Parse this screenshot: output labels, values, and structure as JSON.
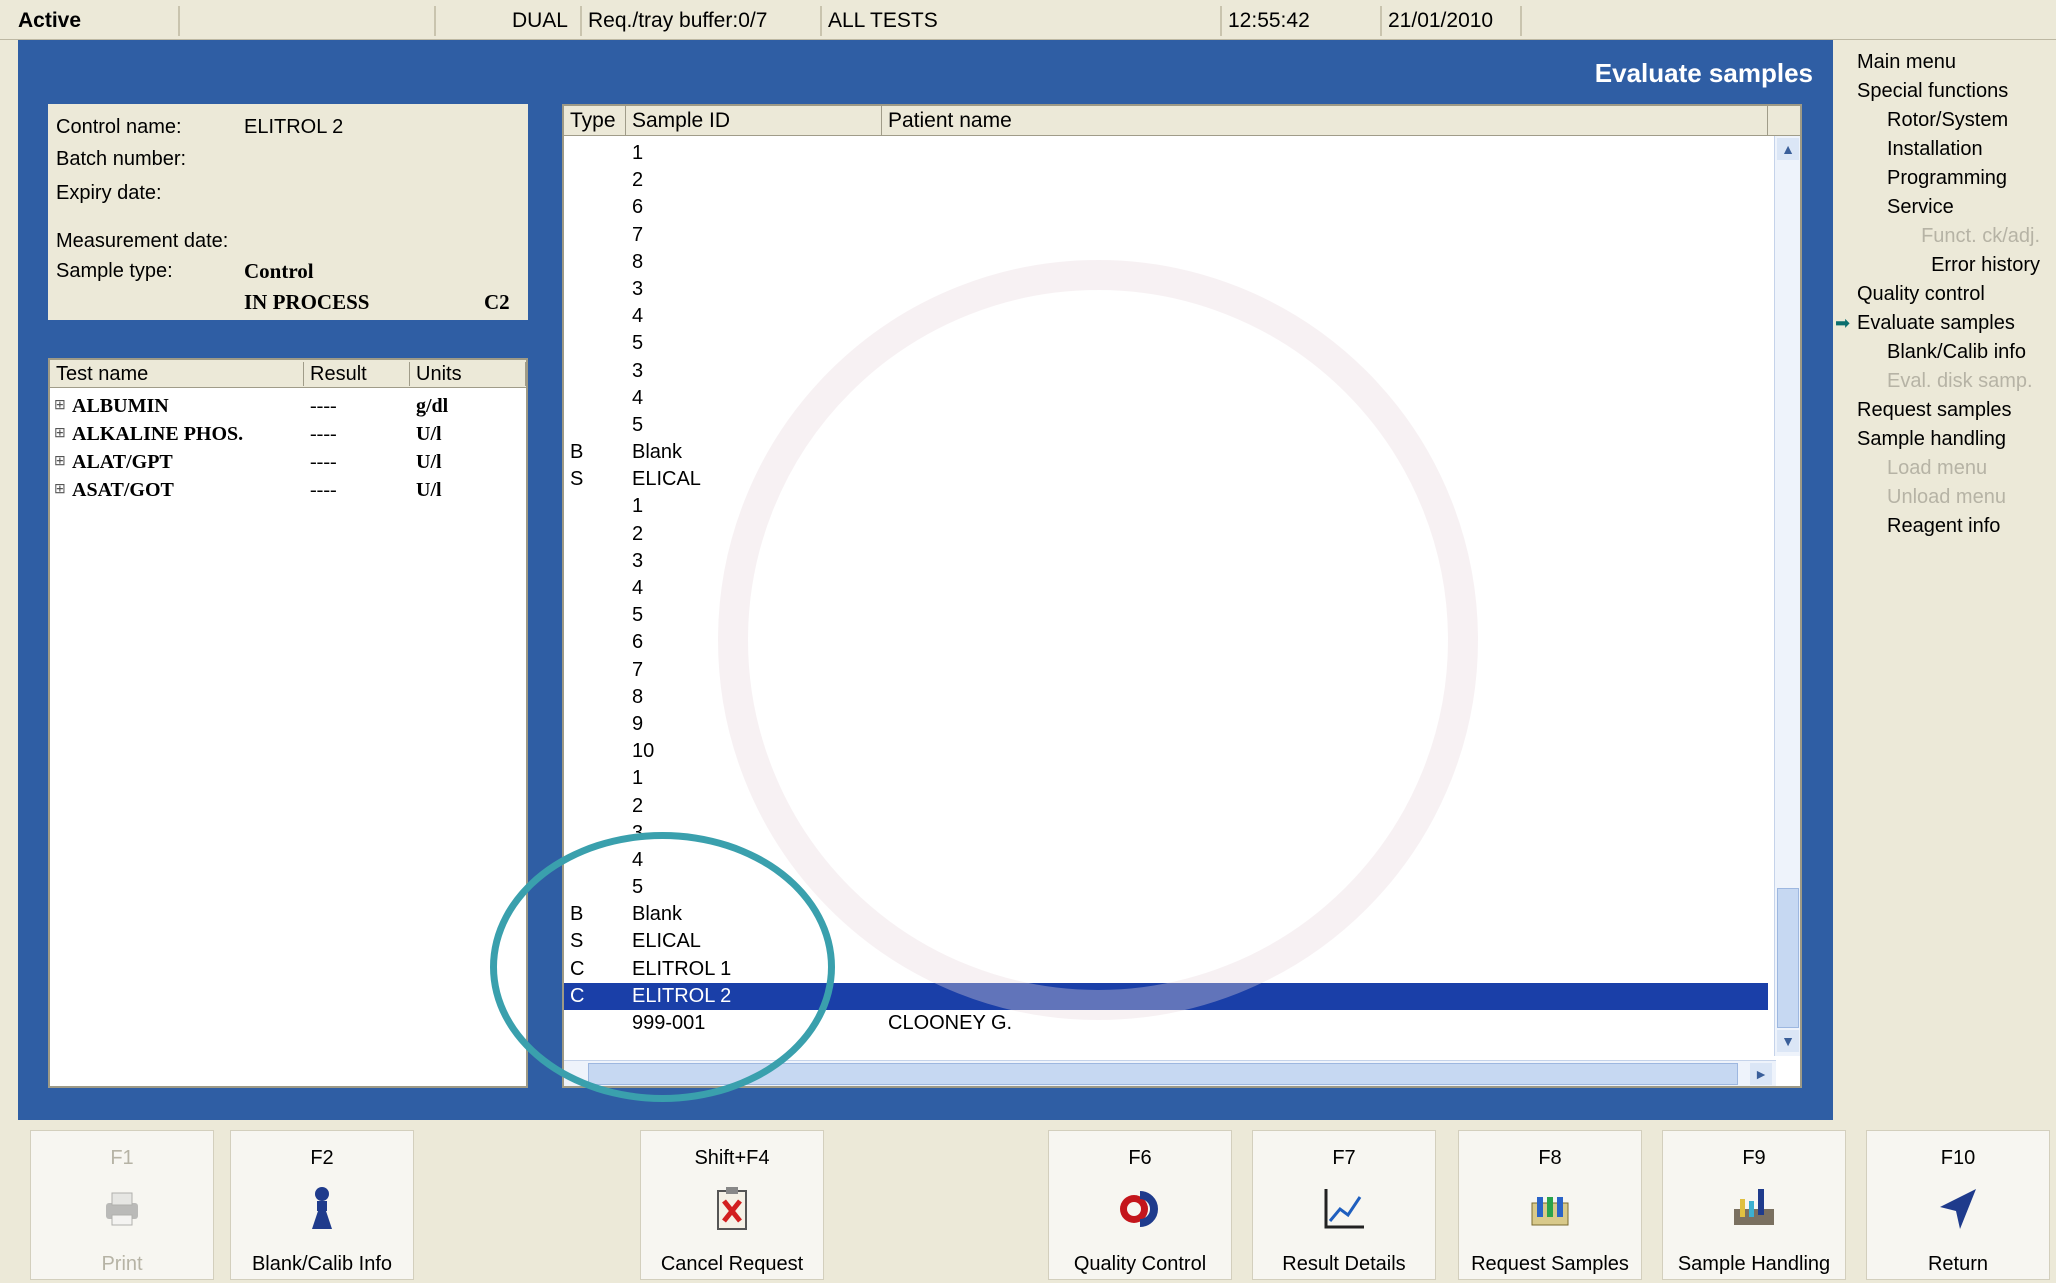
{
  "status_bar": {
    "state": "Active",
    "mode": "DUAL",
    "buffer": "Req./tray buffer:0/7",
    "tests": "ALL TESTS",
    "time": "12:55:42",
    "date": "21/01/2010"
  },
  "screen_title": "Evaluate samples",
  "control_info": {
    "control_name_label": "Control name:",
    "control_name_value": "ELITROL 2",
    "batch_number_label": "Batch number:",
    "expiry_date_label": "Expiry date:",
    "measurement_date_label": "Measurement date:",
    "sample_type_label": "Sample type:",
    "sample_type_value": "Control",
    "status_value": "IN PROCESS",
    "position_value": "C2"
  },
  "test_table": {
    "headers": [
      "Test name",
      "Result",
      "Units"
    ],
    "rows": [
      {
        "name": "ALBUMIN",
        "result": "----",
        "units": "g/dl"
      },
      {
        "name": "ALKALINE PHOS.",
        "result": "----",
        "units": "U/l"
      },
      {
        "name": "ALAT/GPT",
        "result": "----",
        "units": "U/l"
      },
      {
        "name": "ASAT/GOT",
        "result": "----",
        "units": "U/l"
      }
    ]
  },
  "sample_list": {
    "headers": [
      "Type",
      "Sample ID",
      "Patient name"
    ],
    "rows": [
      {
        "type": "",
        "id": "1",
        "patient": ""
      },
      {
        "type": "",
        "id": "2",
        "patient": ""
      },
      {
        "type": "",
        "id": "6",
        "patient": ""
      },
      {
        "type": "",
        "id": "7",
        "patient": ""
      },
      {
        "type": "",
        "id": "8",
        "patient": ""
      },
      {
        "type": "",
        "id": "3",
        "patient": ""
      },
      {
        "type": "",
        "id": "4",
        "patient": ""
      },
      {
        "type": "",
        "id": "5",
        "patient": ""
      },
      {
        "type": "",
        "id": "3",
        "patient": ""
      },
      {
        "type": "",
        "id": "4",
        "patient": ""
      },
      {
        "type": "",
        "id": "5",
        "patient": ""
      },
      {
        "type": "B",
        "id": "Blank",
        "patient": ""
      },
      {
        "type": "S",
        "id": "ELICAL",
        "patient": ""
      },
      {
        "type": "",
        "id": "1",
        "patient": ""
      },
      {
        "type": "",
        "id": "2",
        "patient": ""
      },
      {
        "type": "",
        "id": "3",
        "patient": ""
      },
      {
        "type": "",
        "id": "4",
        "patient": ""
      },
      {
        "type": "",
        "id": "5",
        "patient": ""
      },
      {
        "type": "",
        "id": "6",
        "patient": ""
      },
      {
        "type": "",
        "id": "7",
        "patient": ""
      },
      {
        "type": "",
        "id": "8",
        "patient": ""
      },
      {
        "type": "",
        "id": "9",
        "patient": ""
      },
      {
        "type": "",
        "id": "10",
        "patient": ""
      },
      {
        "type": "",
        "id": "1",
        "patient": ""
      },
      {
        "type": "",
        "id": "2",
        "patient": ""
      },
      {
        "type": "",
        "id": "3",
        "patient": ""
      },
      {
        "type": "",
        "id": "4",
        "patient": ""
      },
      {
        "type": "",
        "id": "5",
        "patient": ""
      },
      {
        "type": "B",
        "id": "Blank",
        "patient": ""
      },
      {
        "type": "S",
        "id": "ELICAL",
        "patient": ""
      },
      {
        "type": "C",
        "id": "ELITROL 1",
        "patient": ""
      },
      {
        "type": "C",
        "id": "ELITROL 2",
        "patient": "",
        "selected": true
      },
      {
        "type": "",
        "id": "999-001",
        "patient": "CLOONEY G."
      }
    ]
  },
  "side_menu": [
    {
      "label": "Main menu",
      "level": 0,
      "enabled": true
    },
    {
      "label": "Special functions",
      "level": 0,
      "enabled": true
    },
    {
      "label": "Rotor/System",
      "level": 1,
      "enabled": true
    },
    {
      "label": "Installation",
      "level": 1,
      "enabled": true
    },
    {
      "label": "Programming",
      "level": 1,
      "enabled": true
    },
    {
      "label": "Service",
      "level": 1,
      "enabled": true
    },
    {
      "label": "Funct. ck/adj.",
      "level": 2,
      "enabled": false
    },
    {
      "label": "Error history",
      "level": 2,
      "enabled": true
    },
    {
      "label": "Quality control",
      "level": 0,
      "enabled": true
    },
    {
      "label": "Evaluate samples",
      "level": 0,
      "enabled": true,
      "active": true
    },
    {
      "label": "Blank/Calib info",
      "level": 1,
      "enabled": true
    },
    {
      "label": "Eval. disk samp.",
      "level": 1,
      "enabled": false
    },
    {
      "label": "Request samples",
      "level": 0,
      "enabled": true
    },
    {
      "label": "Sample handling",
      "level": 0,
      "enabled": true
    },
    {
      "label": "Load menu",
      "level": 1,
      "enabled": false
    },
    {
      "label": "Unload menu",
      "level": 1,
      "enabled": false
    },
    {
      "label": "Reagent info",
      "level": 1,
      "enabled": true
    }
  ],
  "function_keys": [
    {
      "key": "F1",
      "label": "Print",
      "icon": "printer-icon",
      "enabled": false
    },
    {
      "key": "F2",
      "label": "Blank/Calib Info",
      "icon": "flask-icon",
      "enabled": true
    },
    {
      "key": "Shift+F4",
      "label": "Cancel Request",
      "icon": "cancel-document-icon",
      "enabled": true
    },
    {
      "key": "F6",
      "label": "Quality Control",
      "icon": "qc-icon",
      "enabled": true
    },
    {
      "key": "F7",
      "label": "Result Details",
      "icon": "chart-icon",
      "enabled": true
    },
    {
      "key": "F8",
      "label": "Request Samples",
      "icon": "sample-rack-icon",
      "enabled": true
    },
    {
      "key": "F9",
      "label": "Sample Handling",
      "icon": "tube-handling-icon",
      "enabled": true
    },
    {
      "key": "F10",
      "label": "Return",
      "icon": "return-arrow-icon",
      "enabled": true
    }
  ],
  "colors": {
    "frame_blue": "#2f5ea4",
    "selection_blue": "#1a3fa8",
    "highlight_ring": "#3aa0ad"
  }
}
